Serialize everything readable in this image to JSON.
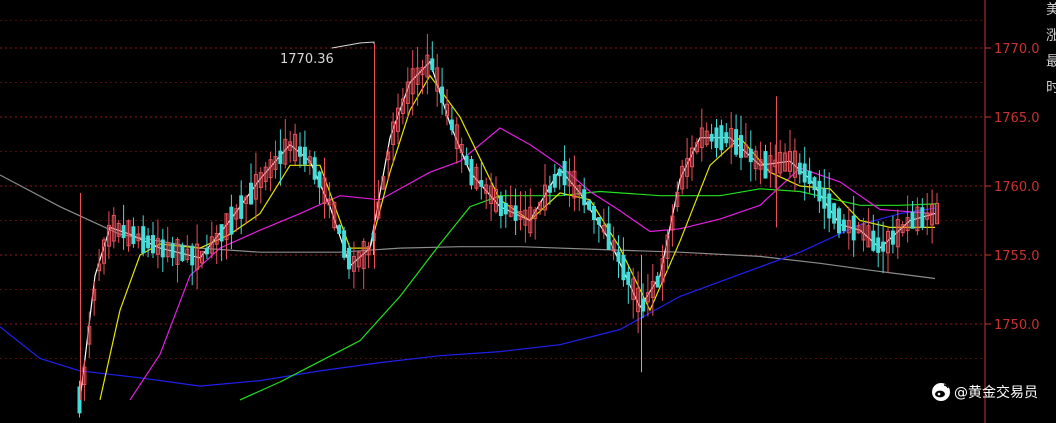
{
  "chart_data": {
    "type": "candlestick",
    "y_ticks": [
      1770,
      1765,
      1760,
      1755,
      1750
    ],
    "y_tick_labels": [
      "1770.0",
      "1765.0",
      "1760.0",
      "1755.0",
      "1750.0"
    ],
    "ylim": [
      1744.5,
      1772.2
    ],
    "grid": true,
    "peak_annotation": {
      "text": "1770.36",
      "value": 1770.36
    },
    "colors": {
      "background": "#000000",
      "grid": "#8b1a1a",
      "axis": "#c83232",
      "up_candle": "#e8515a",
      "down_candle": "#44dcd8",
      "ma_fast": "#ffffff",
      "ma_2": "#e6e600",
      "ma_3": "#e020e0",
      "ma_4": "#20e020",
      "ma_5": "#2020ee",
      "ma_6": "#8c8c8c"
    },
    "candles": [],
    "series": [
      {
        "color_key": "ma_6",
        "points": [
          [
            0,
            1760.8
          ],
          [
            60,
            1758.5
          ],
          [
            120,
            1756.5
          ],
          [
            200,
            1755.5
          ],
          [
            260,
            1755.2
          ],
          [
            340,
            1755.2
          ],
          [
            400,
            1755.5
          ],
          [
            460,
            1755.6
          ],
          [
            520,
            1755.6
          ],
          [
            600,
            1755.4
          ],
          [
            680,
            1755.2
          ],
          [
            760,
            1754.9
          ],
          [
            820,
            1754.4
          ],
          [
            870,
            1753.9
          ],
          [
            935,
            1753.3
          ]
        ]
      },
      {
        "color_key": "ma_5",
        "points": [
          [
            0,
            1749.8
          ],
          [
            40,
            1747.5
          ],
          [
            80,
            1746.6
          ],
          [
            140,
            1746.1
          ],
          [
            200,
            1745.5
          ],
          [
            260,
            1745.9
          ],
          [
            320,
            1746.6
          ],
          [
            380,
            1747.2
          ],
          [
            440,
            1747.7
          ],
          [
            500,
            1748.0
          ],
          [
            560,
            1748.5
          ],
          [
            620,
            1749.6
          ],
          [
            680,
            1752.0
          ],
          [
            740,
            1753.6
          ],
          [
            800,
            1755.2
          ],
          [
            860,
            1757.2
          ],
          [
            900,
            1758.0
          ],
          [
            935,
            1758.4
          ]
        ]
      },
      {
        "color_key": "ma_4",
        "points": [
          [
            240,
            1744.5
          ],
          [
            280,
            1745.8
          ],
          [
            320,
            1747.3
          ],
          [
            360,
            1748.8
          ],
          [
            400,
            1752.0
          ],
          [
            440,
            1755.8
          ],
          [
            470,
            1758.5
          ],
          [
            500,
            1759.3
          ],
          [
            560,
            1759.3
          ],
          [
            600,
            1759.6
          ],
          [
            660,
            1759.3
          ],
          [
            720,
            1759.3
          ],
          [
            760,
            1759.8
          ],
          [
            800,
            1759.6
          ],
          [
            860,
            1758.6
          ],
          [
            900,
            1758.6
          ],
          [
            935,
            1758.7
          ]
        ]
      },
      {
        "color_key": "ma_3",
        "points": [
          [
            130,
            1744.5
          ],
          [
            160,
            1747.8
          ],
          [
            190,
            1753.5
          ],
          [
            220,
            1755.5
          ],
          [
            260,
            1756.8
          ],
          [
            300,
            1758.0
          ],
          [
            340,
            1759.3
          ],
          [
            380,
            1759.0
          ],
          [
            430,
            1761.0
          ],
          [
            460,
            1761.8
          ],
          [
            500,
            1764.2
          ],
          [
            530,
            1763.0
          ],
          [
            560,
            1761.5
          ],
          [
            590,
            1759.6
          ],
          [
            620,
            1758.2
          ],
          [
            650,
            1756.7
          ],
          [
            680,
            1756.9
          ],
          [
            720,
            1757.6
          ],
          [
            760,
            1758.6
          ],
          [
            800,
            1761.3
          ],
          [
            840,
            1760.3
          ],
          [
            880,
            1758.3
          ],
          [
            935,
            1758.0
          ]
        ]
      },
      {
        "color_key": "ma_2",
        "points": [
          [
            100,
            1744.5
          ],
          [
            120,
            1751.0
          ],
          [
            140,
            1755.0
          ],
          [
            160,
            1755.8
          ],
          [
            200,
            1755.5
          ],
          [
            230,
            1756.5
          ],
          [
            260,
            1758.0
          ],
          [
            290,
            1761.5
          ],
          [
            320,
            1761.5
          ],
          [
            350,
            1755.5
          ],
          [
            370,
            1755.5
          ],
          [
            390,
            1761.0
          ],
          [
            410,
            1765.5
          ],
          [
            430,
            1768.0
          ],
          [
            460,
            1765.0
          ],
          [
            500,
            1759.0
          ],
          [
            530,
            1757.5
          ],
          [
            560,
            1759.5
          ],
          [
            590,
            1759.0
          ],
          [
            620,
            1755.5
          ],
          [
            650,
            1751.0
          ],
          [
            680,
            1756.0
          ],
          [
            710,
            1761.5
          ],
          [
            740,
            1763.5
          ],
          [
            770,
            1761.0
          ],
          [
            800,
            1760.0
          ],
          [
            830,
            1759.8
          ],
          [
            860,
            1757.5
          ],
          [
            890,
            1757.0
          ],
          [
            935,
            1757.0
          ]
        ]
      },
      {
        "color_key": "ma_fast",
        "points": [
          [
            80,
            1744.5
          ],
          [
            95,
            1753.5
          ],
          [
            110,
            1757.0
          ],
          [
            130,
            1756.5
          ],
          [
            160,
            1755.5
          ],
          [
            200,
            1754.8
          ],
          [
            230,
            1757.5
          ],
          [
            260,
            1760.5
          ],
          [
            290,
            1763.0
          ],
          [
            310,
            1761.8
          ],
          [
            330,
            1758.5
          ],
          [
            350,
            1754.2
          ],
          [
            370,
            1755.5
          ],
          [
            390,
            1763.5
          ],
          [
            410,
            1767.5
          ],
          [
            430,
            1769.0
          ],
          [
            450,
            1764.5
          ],
          [
            470,
            1761.0
          ],
          [
            500,
            1758.5
          ],
          [
            530,
            1757.5
          ],
          [
            560,
            1761.2
          ],
          [
            580,
            1759.5
          ],
          [
            610,
            1756.0
          ],
          [
            640,
            1751.2
          ],
          [
            660,
            1753.5
          ],
          [
            680,
            1760.5
          ],
          [
            700,
            1763.5
          ],
          [
            730,
            1763.5
          ],
          [
            760,
            1761.5
          ],
          [
            790,
            1761.8
          ],
          [
            810,
            1760.5
          ],
          [
            840,
            1757.2
          ],
          [
            860,
            1756.8
          ],
          [
            880,
            1755.5
          ],
          [
            910,
            1757.5
          ],
          [
            935,
            1758.0
          ]
        ]
      }
    ]
  },
  "right_edge_glyphs": [
    "美",
    "涨",
    "最",
    "时"
  ],
  "watermark": {
    "icon": "weibo-icon",
    "text": "@黄金交易员"
  }
}
